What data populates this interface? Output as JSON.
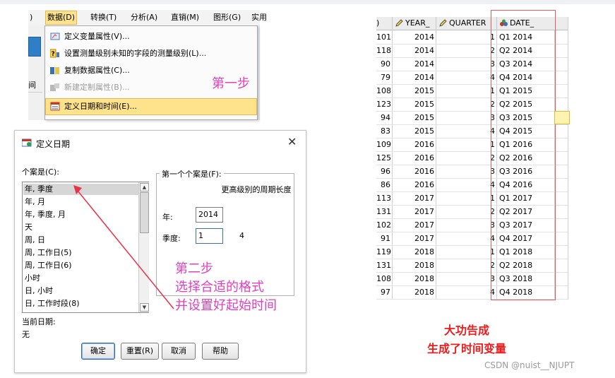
{
  "menu": {
    "bar": [
      {
        "label": ")",
        "active": false
      },
      {
        "label": "数据(D)",
        "active": true
      },
      {
        "label": "转换(T)",
        "active": false
      },
      {
        "label": "分析(A)",
        "active": false
      },
      {
        "label": "直销(M)",
        "active": false
      },
      {
        "label": "图形(G)",
        "active": false
      },
      {
        "label": "实用",
        "active": false
      }
    ],
    "background_cell": "间",
    "items": [
      {
        "label": "定义变量属性(V)...",
        "icon": "define-variable-properties-icon",
        "state": "normal"
      },
      {
        "label": "设置测量级别未知的字段的测量级别(L)...",
        "icon": "measurement-level-icon",
        "state": "normal"
      },
      {
        "label": "复制数据属性(C)...",
        "icon": "copy-data-properties-icon",
        "state": "normal"
      },
      {
        "label": "新建定制属性(B)...",
        "icon": "new-custom-attribute-icon",
        "state": "disabled"
      },
      {
        "label": "定义日期和时间(E)...",
        "icon": "define-dates-icon",
        "state": "highlighted"
      }
    ],
    "annotation": "第一步"
  },
  "dialog": {
    "title": "定义日期",
    "close_glyph": "✕",
    "cases_label": "个案是(C):",
    "list": [
      {
        "label": "年, 季度",
        "selected": true
      },
      {
        "label": "年, 月",
        "selected": false
      },
      {
        "label": "年, 季度, 月",
        "selected": false
      },
      {
        "label": "天",
        "selected": false
      },
      {
        "label": "周, 日",
        "selected": false
      },
      {
        "label": "周, 工作日(5)",
        "selected": false
      },
      {
        "label": "周, 工作日(6)",
        "selected": false
      },
      {
        "label": "小时",
        "selected": false
      },
      {
        "label": "日, 小时",
        "selected": false
      },
      {
        "label": "日, 工作时段(8)",
        "selected": false
      }
    ],
    "current_date_label": "当前日期:",
    "current_date_value": "无",
    "first_case_group": "第一个个案是(F):",
    "higher_level_period": "更高级别的周期长度",
    "year_label": "年:",
    "year_value": "2014",
    "quarter_label": "季度:",
    "quarter_value": "1",
    "quarter_period": "4",
    "buttons": {
      "ok": "确定",
      "reset": "重置(R)",
      "cancel": "取消",
      "help": "帮助"
    }
  },
  "annotation2": [
    "第二步",
    "选择合适的格式",
    "并设置好起始时间"
  ],
  "table": {
    "columns": [
      {
        "label": ")",
        "icon": ""
      },
      {
        "label": "YEAR_",
        "icon": "pencil-icon"
      },
      {
        "label": "QUARTER",
        "icon": "pencil-icon"
      },
      {
        "label": "DATE_",
        "icon": "nominal-icon"
      }
    ],
    "rows": [
      [
        "101",
        "2014",
        "1",
        "Q1 2014"
      ],
      [
        "118",
        "2014",
        "2",
        "Q2 2014"
      ],
      [
        "90",
        "2014",
        "3",
        "Q3 2014"
      ],
      [
        "79",
        "2014",
        "4",
        "Q4 2014"
      ],
      [
        "108",
        "2015",
        "1",
        "Q1 2015"
      ],
      [
        "123",
        "2015",
        "2",
        "Q2 2015"
      ],
      [
        "94",
        "2015",
        "3",
        "Q3 2015"
      ],
      [
        "83",
        "2015",
        "4",
        "Q4 2015"
      ],
      [
        "109",
        "2016",
        "1",
        "Q1 2016"
      ],
      [
        "125",
        "2016",
        "2",
        "Q2 2016"
      ],
      [
        "96",
        "2016",
        "3",
        "Q3 2016"
      ],
      [
        "86",
        "2016",
        "4",
        "Q4 2016"
      ],
      [
        "113",
        "2017",
        "1",
        "Q1 2017"
      ],
      [
        "131",
        "2017",
        "2",
        "Q2 2017"
      ],
      [
        "102",
        "2017",
        "3",
        "Q3 2017"
      ],
      [
        "91",
        "2017",
        "4",
        "Q4 2017"
      ],
      [
        "119",
        "2018",
        "1",
        "Q1 2018"
      ],
      [
        "131",
        "2018",
        "2",
        "Q2 2018"
      ],
      [
        "108",
        "2018",
        "3",
        "Q3 2018"
      ],
      [
        "97",
        "2018",
        "4",
        "Q4 2018"
      ]
    ]
  },
  "result": [
    "大功告成",
    "生成了时间变量"
  ],
  "watermark": "CSDN @nuist__NJUPT",
  "colors": {
    "annotation": "#e040c0",
    "result": "#ee1c1c",
    "arrow": "#e8334a",
    "highlight": "#ffe28c",
    "red_box": "#e85a5a"
  }
}
